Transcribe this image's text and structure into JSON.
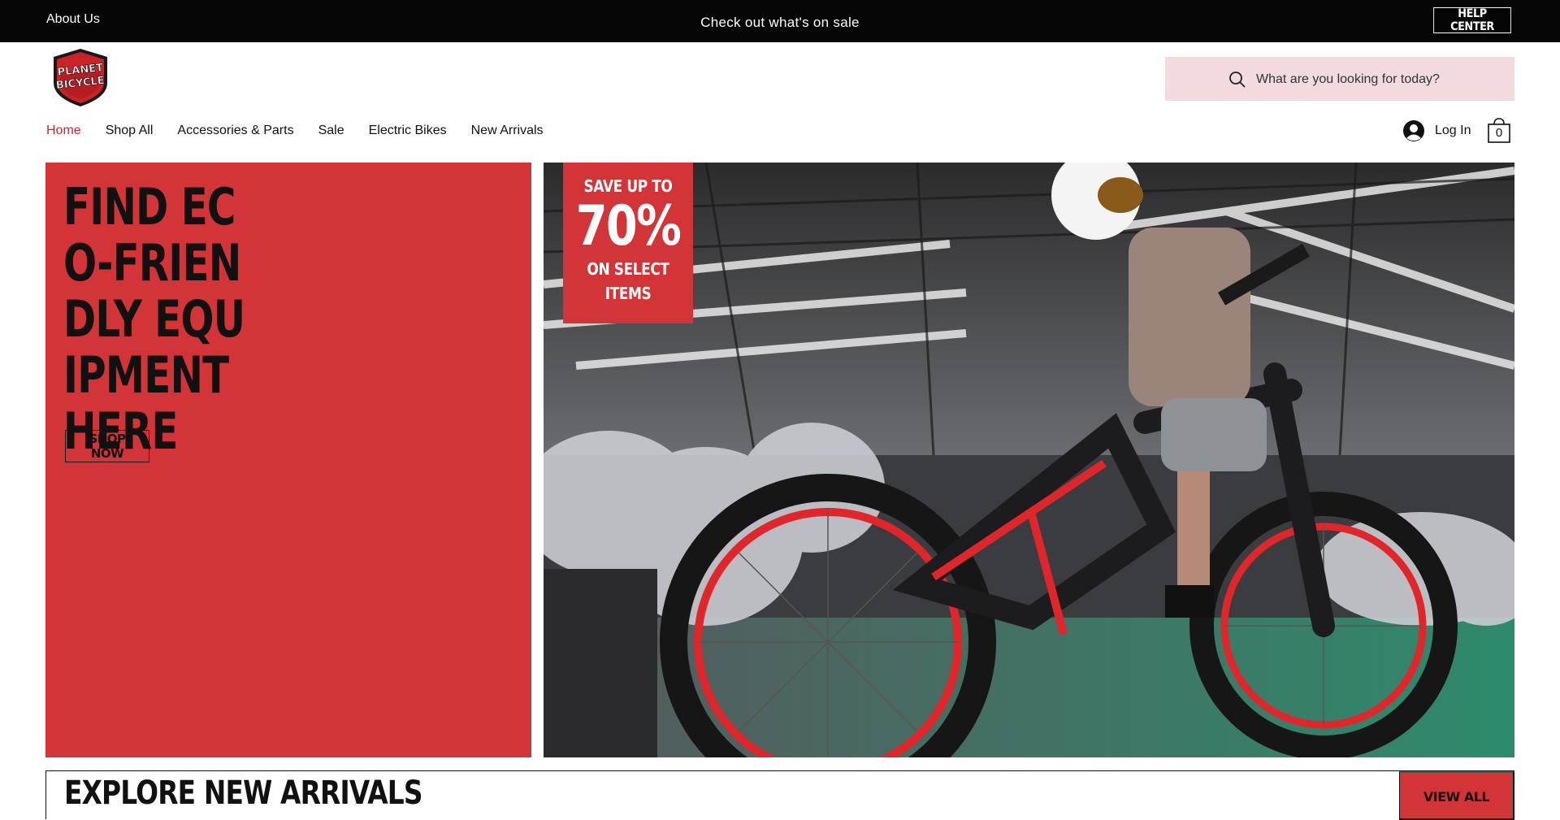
{
  "topbar": {
    "about_label": "About Us",
    "promo_text": "Check out what's on sale",
    "help_label": "HELP CENTER"
  },
  "logo": {
    "line1": "PLANET",
    "line2": "BICYCLE",
    "icon": "planet-bicycle-shield-logo"
  },
  "search": {
    "placeholder": "What are you looking for today?",
    "value": "",
    "icon": "search-icon"
  },
  "nav": {
    "items": [
      {
        "label": "Home",
        "active": true
      },
      {
        "label": "Shop All"
      },
      {
        "label": "Accessories & Parts"
      },
      {
        "label": "Sale"
      },
      {
        "label": "Electric Bikes"
      },
      {
        "label": "New Arrivals"
      }
    ]
  },
  "account": {
    "login_label": "Log In",
    "cart_count": "0"
  },
  "hero": {
    "headline": "FIND ECO-FRIENDLY EQUIPMENT HERE",
    "cta_label": "SHOP NOW",
    "badge_line1": "SAVE UP TO",
    "badge_big": "70%",
    "badge_line3": "ON SELECT ITEMS",
    "image_description_icon": "e-bike-photo"
  },
  "explore": {
    "title": "EXPLORE NEW ARRIVALS",
    "view_all_label": "VIEW ALL"
  },
  "colors": {
    "brand_red": "#d23438",
    "topbar_bg": "#050505",
    "search_bg": "#f2dade",
    "active_nav": "#c8282c"
  }
}
